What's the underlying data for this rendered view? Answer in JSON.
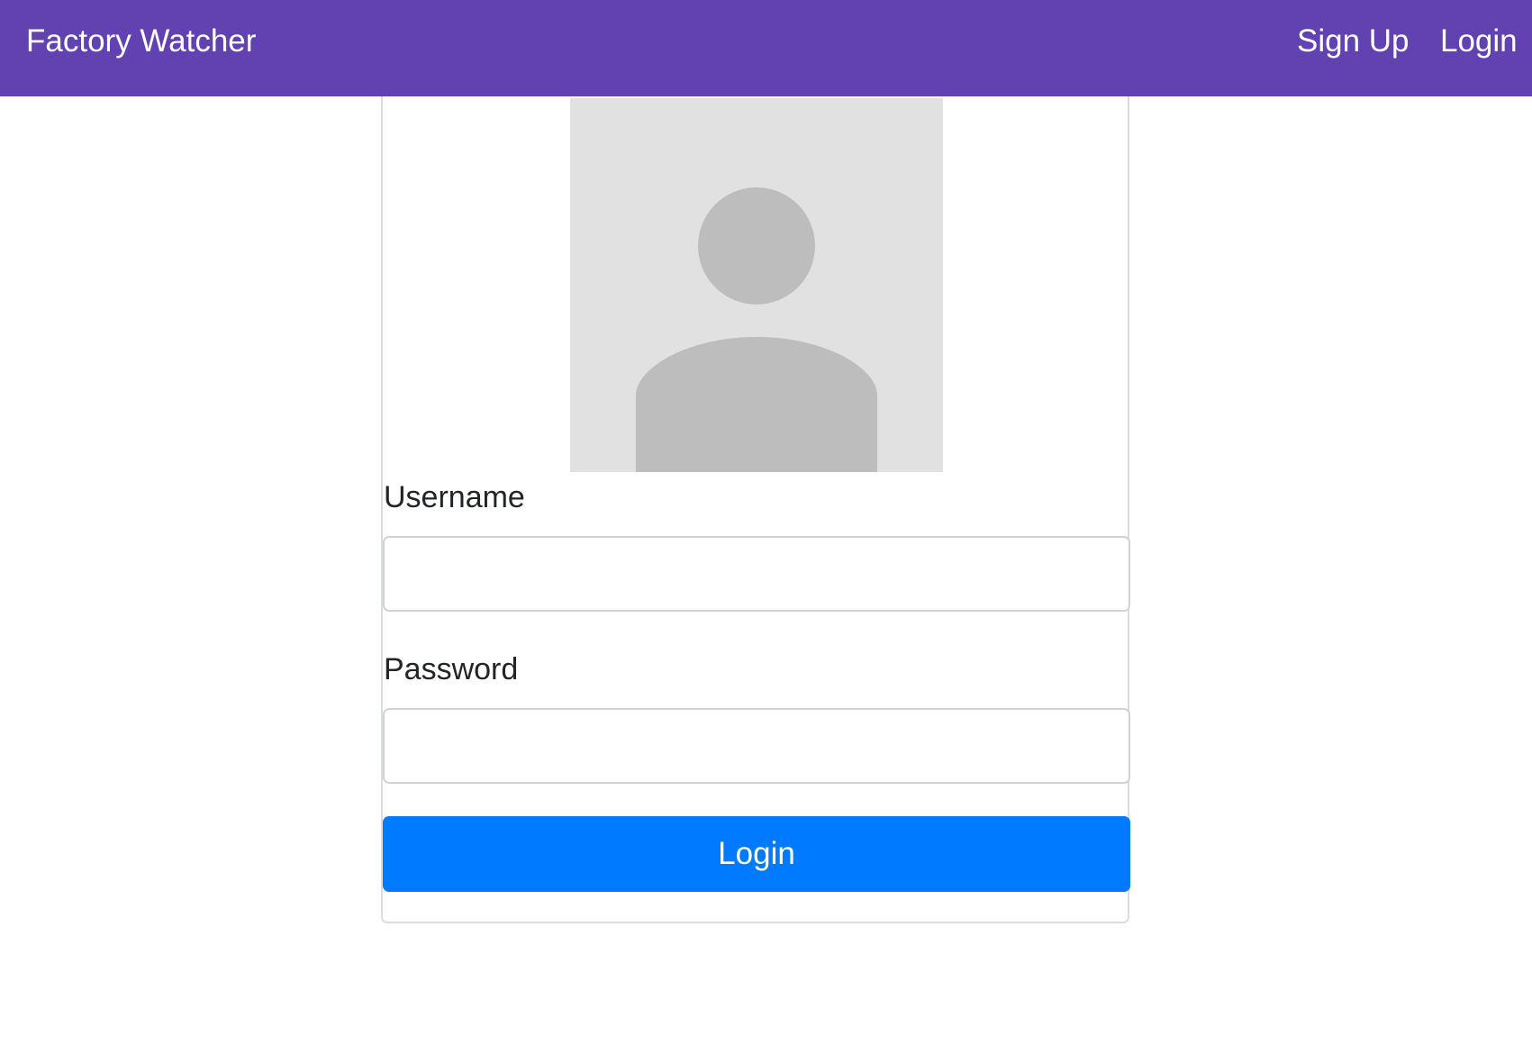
{
  "navbar": {
    "brand": "Factory Watcher",
    "links": {
      "sign_up": "Sign Up",
      "login": "Login"
    },
    "color": "#6241b1"
  },
  "login_form": {
    "avatar_icon": "user-silhouette-icon",
    "username": {
      "label": "Username",
      "value": "",
      "placeholder": ""
    },
    "password": {
      "label": "Password",
      "value": "",
      "placeholder": ""
    },
    "submit_label": "Login",
    "submit_color": "#007bff"
  }
}
